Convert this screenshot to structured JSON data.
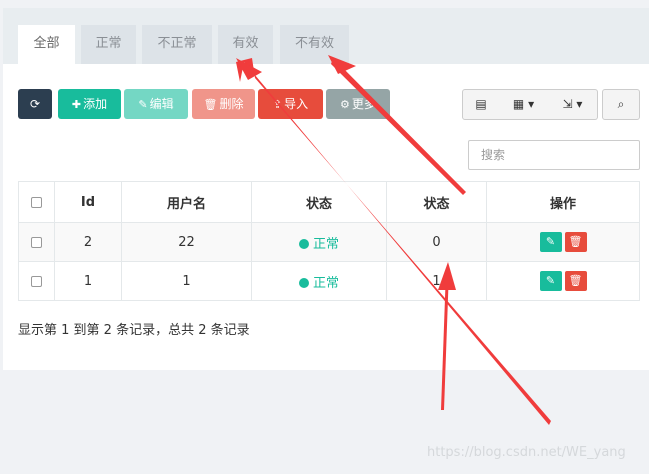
{
  "tabs": [
    {
      "label": "全部",
      "active": true
    },
    {
      "label": "正常",
      "active": false
    },
    {
      "label": "不正常",
      "active": false
    },
    {
      "label": "有效",
      "active": false
    },
    {
      "label": "不有效",
      "active": false
    }
  ],
  "toolbar": {
    "refresh_icon": "refresh-icon",
    "add_label": "添加",
    "edit_label": "编辑",
    "delete_label": "删除",
    "import_label": "导入",
    "more_label": "更多"
  },
  "tools": {
    "list_icon": "list-view-icon",
    "columns_icon": "columns-icon",
    "export_icon": "export-icon",
    "search_icon": "search-icon"
  },
  "search": {
    "placeholder": "搜索"
  },
  "table": {
    "headers": [
      "",
      "Id",
      "用户名",
      "状态",
      "状态",
      "操作"
    ],
    "rows": [
      {
        "id": "2",
        "username": "22",
        "status": "正常",
        "status2": "0"
      },
      {
        "id": "1",
        "username": "1",
        "status": "正常",
        "status2": "1"
      }
    ]
  },
  "footer": {
    "summary": "显示第 1 到第 2 条记录，总共 2 条记录"
  },
  "watermark": "https://blog.csdn.net/WE_yang",
  "colors": {
    "primary": "#18bc9c",
    "danger": "#e74c3c",
    "dark": "#2c3e50",
    "annotation": "#f03c3c"
  }
}
